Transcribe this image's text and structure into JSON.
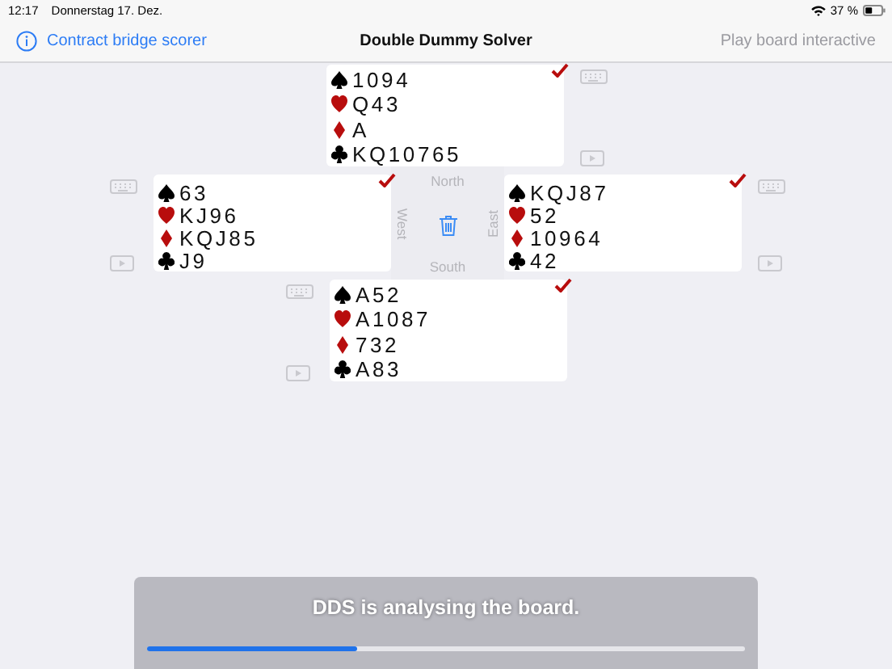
{
  "status_bar": {
    "time": "12:17",
    "date": "Donnerstag 17. Dez.",
    "battery": "37 %"
  },
  "nav": {
    "left_button": "Contract bridge scorer",
    "title": "Double Dummy Solver",
    "right_button": {
      "label": "Play board interactive",
      "disabled": true
    }
  },
  "hands": [
    {
      "kind": "north",
      "checked": true,
      "suits": [
        {
          "kind": "spades",
          "cards": "1094"
        },
        {
          "kind": "hearts",
          "cards": "Q43"
        },
        {
          "kind": "diamonds",
          "cards": "A"
        },
        {
          "kind": "clubs",
          "cards": "KQ10765"
        }
      ]
    },
    {
      "kind": "west",
      "checked": true,
      "suits": [
        {
          "kind": "spades",
          "cards": "63"
        },
        {
          "kind": "hearts",
          "cards": "KJ96"
        },
        {
          "kind": "diamonds",
          "cards": "KQJ85"
        },
        {
          "kind": "clubs",
          "cards": "J9"
        }
      ]
    },
    {
      "kind": "east",
      "checked": true,
      "suits": [
        {
          "kind": "spades",
          "cards": "KQJ87"
        },
        {
          "kind": "hearts",
          "cards": "52"
        },
        {
          "kind": "diamonds",
          "cards": "10964"
        },
        {
          "kind": "clubs",
          "cards": "42"
        }
      ]
    },
    {
      "kind": "south",
      "checked": true,
      "suits": [
        {
          "kind": "spades",
          "cards": "A52"
        },
        {
          "kind": "hearts",
          "cards": "A1087"
        },
        {
          "kind": "diamonds",
          "cards": "732"
        },
        {
          "kind": "clubs",
          "cards": "A83"
        }
      ]
    }
  ],
  "compass": {
    "north": "North",
    "west": "West",
    "east": "East",
    "south": "South"
  },
  "progress": {
    "message": "DDS is analysing the board.",
    "level": 0.35
  }
}
